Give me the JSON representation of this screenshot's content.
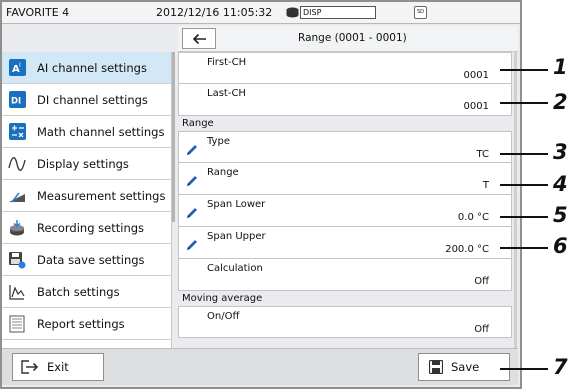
{
  "statusbar": {
    "title": "FAVORITE 4",
    "datetime": "2012/12/16 11:05:32",
    "disp_label": "DISP",
    "sd_label": "SD"
  },
  "header": {
    "title": "Range (0001 - 0001)"
  },
  "sidebar": {
    "items": [
      {
        "label": "AI channel settings",
        "icon": "ai-channel-icon"
      },
      {
        "label": "DI channel settings",
        "icon": "di-channel-icon"
      },
      {
        "label": "Math channel settings",
        "icon": "math-channel-icon"
      },
      {
        "label": "Display settings",
        "icon": "wave-icon"
      },
      {
        "label": "Measurement settings",
        "icon": "gauge-icon"
      },
      {
        "label": "Recording settings",
        "icon": "record-icon"
      },
      {
        "label": "Data save settings",
        "icon": "data-save-icon"
      },
      {
        "label": "Batch settings",
        "icon": "batch-icon"
      },
      {
        "label": "Report settings",
        "icon": "report-icon"
      }
    ]
  },
  "main": {
    "first_ch": {
      "label": "First-CH",
      "value": "0001"
    },
    "last_ch": {
      "label": "Last-CH",
      "value": "0001"
    },
    "range_section": "Range",
    "type": {
      "label": "Type",
      "value": "TC"
    },
    "range": {
      "label": "Range",
      "value": "T"
    },
    "span_lower": {
      "label": "Span Lower",
      "value": "0.0 °C"
    },
    "span_upper": {
      "label": "Span Upper",
      "value": "200.0 °C"
    },
    "calculation": {
      "label": "Calculation",
      "value": "Off"
    },
    "moving_avg_section": "Moving average",
    "onoff": {
      "label": "On/Off",
      "value": "Off"
    }
  },
  "footer": {
    "exit_label": "Exit",
    "save_label": "Save"
  },
  "callouts": [
    "1",
    "2",
    "3",
    "4",
    "5",
    "6",
    "7"
  ],
  "colors": {
    "active_item": "#d3e8f6",
    "pencil": "#1f64b4",
    "ai_icon": "#1a6fbf"
  }
}
